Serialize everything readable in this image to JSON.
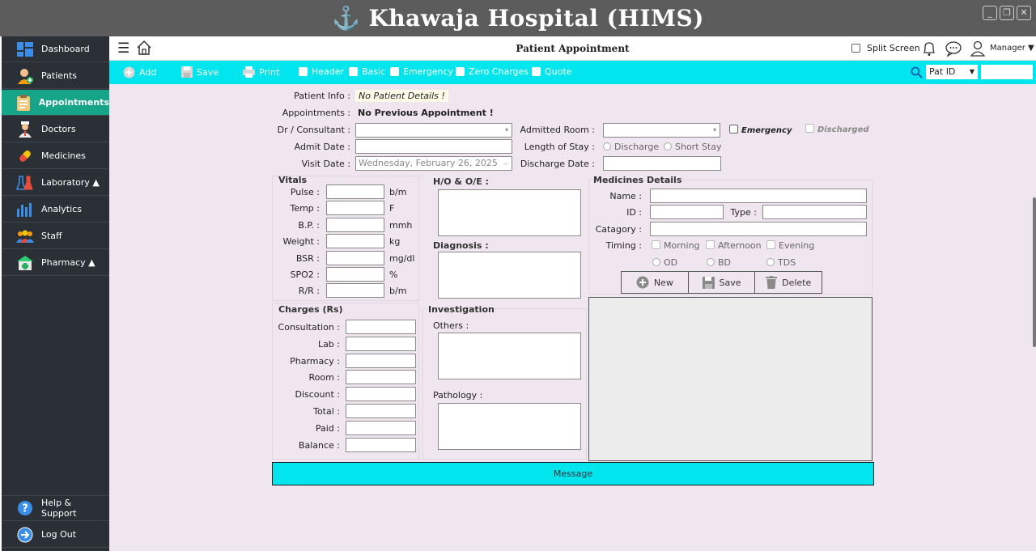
{
  "app": {
    "title": "Khawaja Hospital (HIMS)",
    "window_buttons": [
      "minimize-icon",
      "restore-icon",
      "close-icon"
    ]
  },
  "sidebar": {
    "items": [
      {
        "label": "Dashboard",
        "icon": "dashboard-icon"
      },
      {
        "label": "Patients",
        "icon": "patient-add-icon"
      },
      {
        "label": "Appointments",
        "icon": "clipboard-icon",
        "active": true
      },
      {
        "label": "Doctors",
        "icon": "doctor-icon"
      },
      {
        "label": "Medicines",
        "icon": "pill-icon"
      },
      {
        "label": "Laboratory ▲",
        "icon": "lab-icon"
      },
      {
        "label": "Analytics",
        "icon": "bar-chart-icon"
      },
      {
        "label": "Staff",
        "icon": "staff-icon"
      },
      {
        "label": "Pharmacy ▲",
        "icon": "pharmacy-icon"
      }
    ],
    "bottom": [
      {
        "label": "Help & Support",
        "icon": "help-icon"
      },
      {
        "label": "Log Out",
        "icon": "logout-icon"
      }
    ]
  },
  "header": {
    "page_title": "Patient Appointment",
    "split_screen_label": "Split Screen",
    "user_label": "Manager ▼"
  },
  "toolbar": {
    "add": "Add",
    "save": "Save",
    "print": "Print",
    "checks": [
      "Header",
      "Basic",
      "Emergency",
      "Zero Charges",
      "Quote"
    ],
    "search_by": "Pat ID",
    "search_value": ""
  },
  "form": {
    "patient_info_label": "Patient Info :",
    "patient_info_value": "No Patient Details !",
    "appointments_label": "Appointments :",
    "appointments_value": "No Previous Appointment !",
    "doctor_label": "Dr / Consultant :",
    "admit_date_label": "Admit Date :",
    "visit_date_label": "Visit Date :",
    "visit_date_value": "Wednesday,  February  26, 2025",
    "admitted_room_label": "Admitted Room :",
    "emergency_label": "Emergency",
    "discharged_label": "Discharged",
    "length_of_stay_label": "Length of Stay :",
    "stay_options": [
      "Discharge",
      "Short Stay"
    ],
    "discharge_date_label": "Discharge Date :"
  },
  "vitals": {
    "title": "Vitals",
    "rows": [
      {
        "label": "Pulse :",
        "unit": "b/m"
      },
      {
        "label": "Temp :",
        "unit": "F"
      },
      {
        "label": "B.P. :",
        "unit": "mmh"
      },
      {
        "label": "Weight :",
        "unit": "kg"
      },
      {
        "label": "BSR :",
        "unit": "mg/dl"
      },
      {
        "label": "SPO2 :",
        "unit": "%"
      },
      {
        "label": "R/R :",
        "unit": "b/m"
      }
    ]
  },
  "notes": {
    "ho_title": "H/O & O/E :",
    "diagnosis_title": "Diagnosis :"
  },
  "medicines": {
    "title": "Medicines Details",
    "name_label": "Name :",
    "id_label": "ID :",
    "type_label": "Type :",
    "category_label": "Catagory :",
    "timing_label": "Timing :",
    "timing_checks": [
      "Morning",
      "Afternoon",
      "Evening"
    ],
    "frequency_radios": [
      "OD",
      "BD",
      "TDS"
    ],
    "buttons": [
      "New",
      "Save",
      "Delete"
    ]
  },
  "charges": {
    "title": "Charges (Rs)",
    "rows": [
      "Consultation :",
      "Lab :",
      "Pharmacy :",
      "Room :",
      "Discount :",
      "Total :",
      "Paid :",
      "Balance :"
    ]
  },
  "investigation": {
    "title": "Investigation",
    "others_label": "Others :",
    "pathology_label": "Pathology :"
  },
  "message": "Message",
  "colors": {
    "accent": "#00e5ee",
    "sidebar_bg": "#2b3036",
    "sidebar_active": "#17a589",
    "title_bar": "#5c5c5c",
    "form_bg": "#f0e6f0"
  }
}
